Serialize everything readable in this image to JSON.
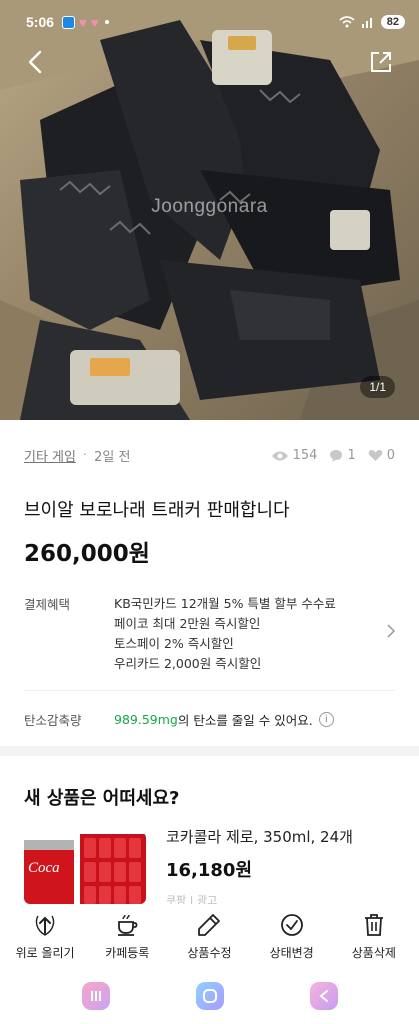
{
  "status_bar": {
    "time": "5:06",
    "battery": "82"
  },
  "photo": {
    "watermark": "Joonggonara",
    "pager": "1/1"
  },
  "icons": {
    "back": "back-arrow-icon",
    "share": "share-icon",
    "views": "eye-icon",
    "chats": "chat-icon",
    "likes": "heart-icon"
  },
  "meta": {
    "category": "기타 게임",
    "time_ago": "2일 전",
    "views": "154",
    "chats": "1",
    "likes": "0"
  },
  "product": {
    "title": "브이알 보로나래 트래커 판매합니다",
    "price": "260,000원"
  },
  "benefits": {
    "label": "결제혜택",
    "lines": [
      "KB국민카드 12개월 5% 특별 할부 수수료",
      "페이코 최대 2만원 즉시할인",
      "토스페이 2% 즉시할인",
      "우리카드 2,000원 즉시할인"
    ]
  },
  "carbon": {
    "label": "탄소감축량",
    "amount": "989.59mg",
    "suffix": "의 탄소를 줄일 수 있어요."
  },
  "recommend": {
    "heading": "새 상품은 어떠세요?",
    "name": "코카콜라 제로, 350ml, 24개",
    "price": "16,180원",
    "seller": "쿠팡",
    "badge": "광고"
  },
  "actions": [
    {
      "label": "위로 올리기",
      "icon": "bump-up-icon"
    },
    {
      "label": "카페등록",
      "icon": "coffee-cup-icon"
    },
    {
      "label": "상품수정",
      "icon": "pencil-icon"
    },
    {
      "label": "상태변경",
      "icon": "check-circle-icon"
    },
    {
      "label": "상품삭제",
      "icon": "trash-icon"
    }
  ],
  "colors": {
    "accent_green": "#14a84a"
  }
}
